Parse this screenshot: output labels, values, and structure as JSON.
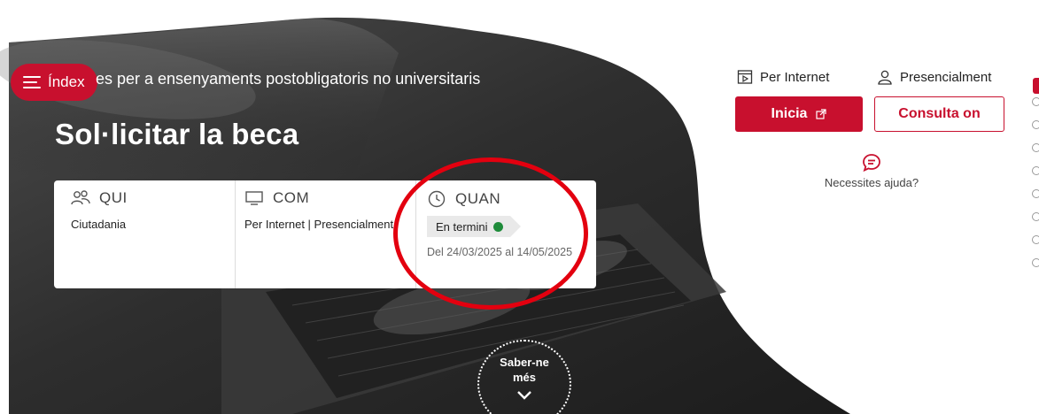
{
  "hero": {
    "subtitle": "es per a ensenyaments postobligatoris no universitaris",
    "title": "Sol·licitar la beca",
    "index_label": "Índex",
    "more_label_1": "Saber-ne",
    "more_label_2": "més"
  },
  "card": {
    "who": {
      "label": "QUI",
      "value": "Ciutadania"
    },
    "how": {
      "label": "COM",
      "value": "Per Internet | Presencialment"
    },
    "when": {
      "label": "QUAN",
      "status": "En termini",
      "status_color": "#1e8b3a",
      "dates": "Del 24/03/2025 al 14/05/2025"
    }
  },
  "panel": {
    "online_label": "Per Internet",
    "in_person_label": "Presencialment",
    "start_label": "Inicia",
    "consult_label": "Consulta on",
    "help_label": "Necessites ajuda?"
  },
  "colors": {
    "accent": "#c8102e",
    "highlight": "#e3000f"
  }
}
